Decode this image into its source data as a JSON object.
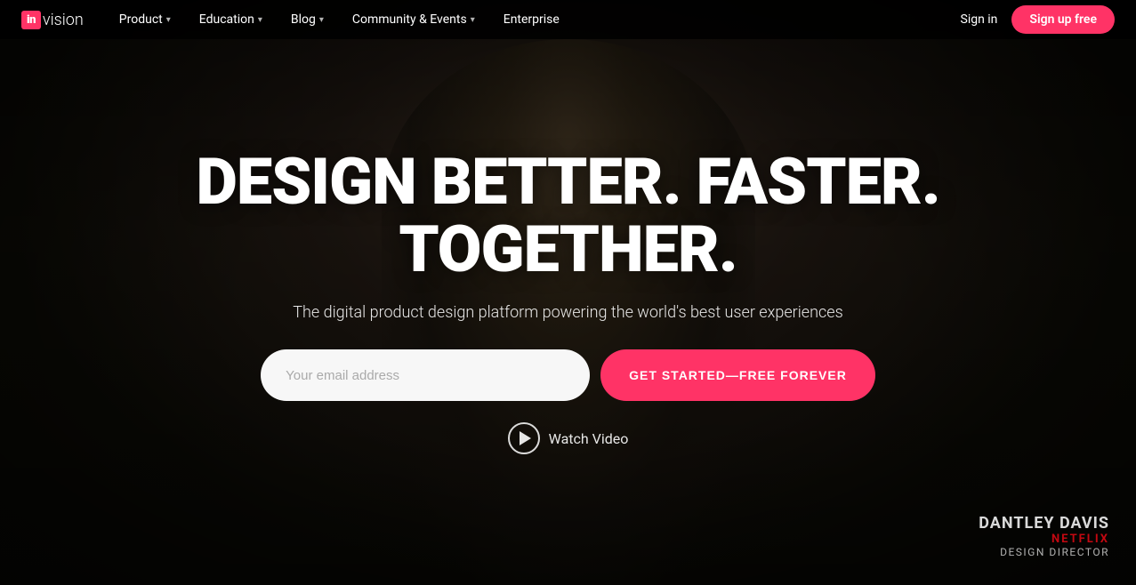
{
  "logo": {
    "badge": "in",
    "text": "vision"
  },
  "nav": {
    "items": [
      {
        "label": "Product",
        "hasDropdown": true
      },
      {
        "label": "Education",
        "hasDropdown": true
      },
      {
        "label": "Blog",
        "hasDropdown": true
      },
      {
        "label": "Community & Events",
        "hasDropdown": true
      },
      {
        "label": "Enterprise",
        "hasDropdown": false
      }
    ],
    "signin_label": "Sign in",
    "signup_label": "Sign up free"
  },
  "hero": {
    "title": "DESIGN BETTER. FASTER. TOGETHER.",
    "subtitle": "The digital product design platform powering the world's best user experiences",
    "email_placeholder": "Your email address",
    "cta_label": "GET STARTED—FREE FOREVER",
    "video_label": "Watch Video"
  },
  "credit": {
    "name": "DANTLEY DAVIS",
    "company": "NETFLIX",
    "role": "DESIGN DIRECTOR"
  }
}
